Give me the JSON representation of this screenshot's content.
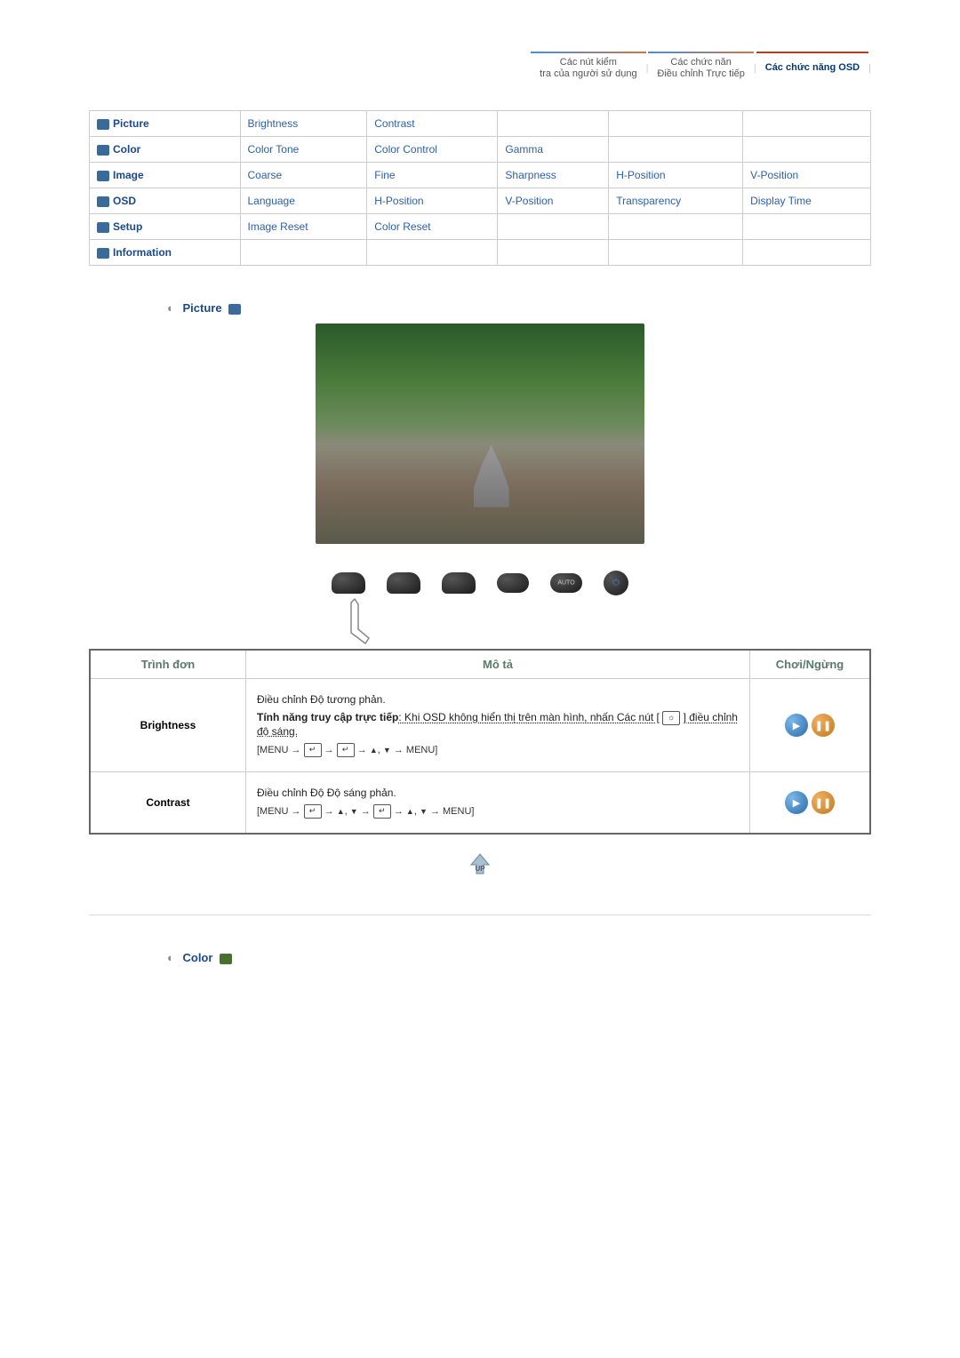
{
  "tabs": {
    "t1_line1": "Các nút kiểm",
    "t1_line2": "tra của người sử dụng",
    "t2_line1": "Các chức năn",
    "t2_line2": "Điều chỉnh Trực tiếp",
    "t3": "Các chức năng OSD"
  },
  "menu_table": {
    "rows": [
      {
        "header": "Picture",
        "cells": [
          "Brightness",
          "Contrast",
          "",
          "",
          ""
        ]
      },
      {
        "header": "Color",
        "cells": [
          "Color Tone",
          "Color Control",
          "Gamma",
          "",
          ""
        ]
      },
      {
        "header": "Image",
        "cells": [
          "Coarse",
          "Fine",
          "Sharpness",
          "H-Position",
          "V-Position"
        ]
      },
      {
        "header": "OSD",
        "cells": [
          "Language",
          "H-Position",
          "V-Position",
          "Transparency",
          "Display Time"
        ]
      },
      {
        "header": "Setup",
        "cells": [
          "Image Reset",
          "Color Reset",
          "",
          "",
          ""
        ]
      },
      {
        "header": "Information",
        "cells": [
          "",
          "",
          "",
          "",
          ""
        ]
      }
    ]
  },
  "sections": {
    "picture_title": "Picture",
    "color_title": "Color"
  },
  "hw_buttons": {
    "b1": "",
    "b2": "",
    "b3": "",
    "b4": "",
    "b5": "AUTO",
    "b6": ""
  },
  "desc_table": {
    "headers": {
      "menu": "Trình đơn",
      "desc": "Mô tả",
      "play": "Chơi/Ngừng"
    },
    "brightness": {
      "name": "Brightness",
      "p1": "Điều chỉnh Độ tương phản.",
      "p2a": "Tính năng truy cập trực tiếp",
      "p2b": ": Khi OSD không hiển thị trên màn hình, nhấn Các nút [",
      "p2c": "] điều chỉnh độ sáng.",
      "seq": "[MENU → ",
      "seq_mid": " → ",
      "seq_mid2": " → ",
      "seq_arrows": ", ",
      "seq_end": " → MENU]"
    },
    "contrast": {
      "name": "Contrast",
      "p1": "Điều chỉnh Độ Độ sáng phản.",
      "seq": "[MENU → ",
      "seq_mid": " → ",
      "seq_arrows": ", ",
      "seq_mid2": " → ",
      "seq_arrows2": ", ",
      "seq_end": " → MENU]"
    }
  },
  "up_label": "UP"
}
